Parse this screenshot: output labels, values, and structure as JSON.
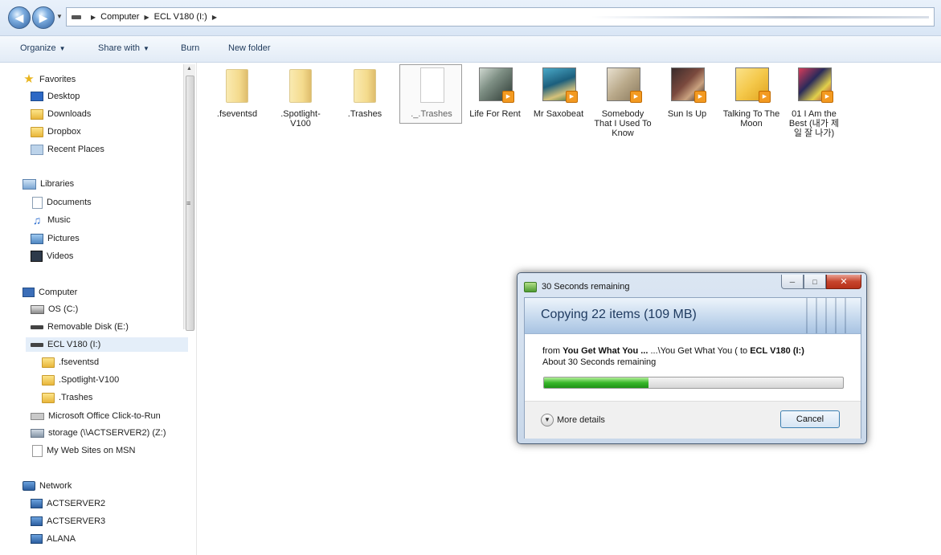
{
  "address": {
    "crumbs": [
      "Computer",
      "ECL V180 (I:)"
    ]
  },
  "toolbar": {
    "organize": "Organize",
    "share_with": "Share with",
    "burn": "Burn",
    "new_folder": "New folder"
  },
  "nav": {
    "favorites": "Favorites",
    "desktop": "Desktop",
    "downloads": "Downloads",
    "dropbox": "Dropbox",
    "recent_places": "Recent Places",
    "libraries": "Libraries",
    "documents": "Documents",
    "music": "Music",
    "pictures": "Pictures",
    "videos": "Videos",
    "computer": "Computer",
    "os_c": "OS (C:)",
    "removable_e": "Removable Disk (E:)",
    "ecl_v180": "ECL V180 (I:)",
    "fseventsd": ".fseventsd",
    "spotlight": ".Spotlight-V100",
    "trashes": ".Trashes",
    "office_ctr": "Microsoft Office Click-to-Run",
    "storage_z": "storage (\\\\ACTSERVER2) (Z:)",
    "msn_sites": "My Web Sites on MSN",
    "network": "Network",
    "actserver2": "ACTSERVER2",
    "actserver3": "ACTSERVER3",
    "alana": "ALANA"
  },
  "files": [
    {
      "name": ".fseventsd"
    },
    {
      "name": ".Spotlight-V100"
    },
    {
      "name": ".Trashes"
    },
    {
      "name": "._.Trashes"
    },
    {
      "name": "Life For Rent"
    },
    {
      "name": "Mr Saxobeat"
    },
    {
      "name": "Somebody That I Used To Know"
    },
    {
      "name": "Sun Is Up"
    },
    {
      "name": "Talking To The Moon"
    },
    {
      "name": "01 I Am the Best (내가 제일 잘 나가)"
    }
  ],
  "dialog": {
    "title": "30 Seconds remaining",
    "heading": "Copying 22 items (109 MB)",
    "from_label": "from",
    "from_source": "You Get What You ...",
    "from_path": "...\\You Get What You ( to",
    "to_dest": "ECL V180 (I:)",
    "about": "About 30 Seconds remaining",
    "progress": 0.35,
    "more_details": "More details",
    "cancel": "Cancel"
  },
  "colors": {
    "progress_fill": "#38b72a",
    "play_badge": "#f39a21"
  }
}
